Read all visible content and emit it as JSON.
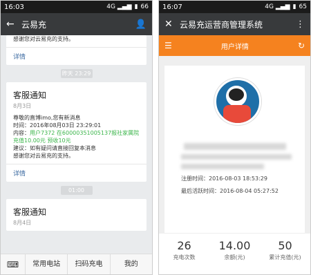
{
  "left": {
    "status": {
      "time": "16:03",
      "battery": "66"
    },
    "header": {
      "title": "云易充"
    },
    "first_card": {
      "tail_text": "感谢您对云易充的支持。",
      "detail_link": "详情"
    },
    "time_pill_1": "昨天 23:29",
    "notice": {
      "title": "客服通知",
      "date": "8月3日",
      "lines": [
        "尊敬的直博imo,您有新消息",
        "时间：2016年08月03日 23:29:01",
        "内容：",
        "用户7372 在60000351005137报社家属院 充值10.00元 预收10元",
        "建议：如有疑问请直接回复本消息",
        "感谢您对云易充的支持。"
      ],
      "detail_link": "详情"
    },
    "time_pill_2": "01:00",
    "next_notice_title": "客服通知",
    "next_notice_date": "8月4日",
    "bottom_nav": {
      "tabs": [
        "常用电站",
        "扫码充电",
        "我的"
      ]
    }
  },
  "right": {
    "status": {
      "time": "16:07",
      "battery": "65"
    },
    "header": {
      "title": "云易充运营商管理系统"
    },
    "orange_title": "用户详情",
    "register_label": "注册时间：2016-08-03 18:53:29",
    "active_label": "最后活跃时间：2016-08-04 05:27:52",
    "stats": [
      {
        "value": "26",
        "label": "充电次数"
      },
      {
        "value": "14.00",
        "label": "余额(元)"
      },
      {
        "value": "50",
        "label": "累计充值(元)"
      }
    ],
    "colors": {
      "accent": "#f5821f",
      "link": "#3b6aa0",
      "highlight": "#3bb54a"
    }
  }
}
